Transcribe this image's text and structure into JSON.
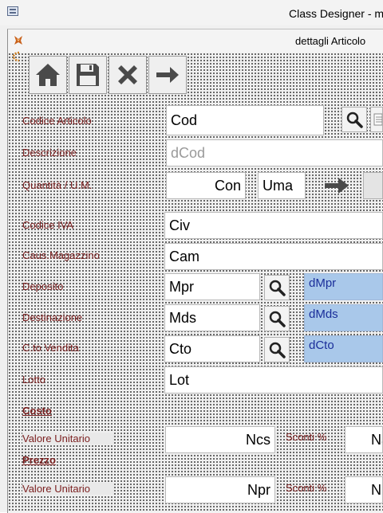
{
  "window": {
    "title": "Class Designer - m"
  },
  "form": {
    "title": "dettagli Articolo"
  },
  "toolbar": {
    "home": {
      "icon": "home-icon"
    },
    "save": {
      "icon": "save-icon"
    },
    "cancel": {
      "icon": "close-icon"
    },
    "next": {
      "icon": "arrow-right-icon"
    }
  },
  "labels": {
    "codice_articolo": "Codice Articolo",
    "descrizione": "Descrizione",
    "quantita_um": "Quantità / U.M.",
    "codice_iva": "Codice IVA",
    "caus_magazzino": "Caus.Magazzino",
    "deposito": "Deposito",
    "destinazione": "Destinazione",
    "cto_vendita": "C.to Vendita",
    "lotto": "Lotto",
    "costo": "Costo",
    "valore_unitario_costo": "Valore Unitario",
    "sconti_costo": "Sconti %",
    "prezzo": "Prezzo",
    "valore_unitario_prezzo": "Valore Unitario",
    "sconti_prezzo": "Sconti %"
  },
  "fields": {
    "cod": "Cod",
    "dcod": "dCod",
    "con": "Con",
    "uma": "Uma",
    "civ": "Civ",
    "cam": "Cam",
    "mpr": "Mpr",
    "dmpr": "dMpr",
    "mds": "Mds",
    "dmds": "dMds",
    "cto": "Cto",
    "dcto": "dCto",
    "lot": "Lot",
    "ncs": "Ncs",
    "sconti_costo_val": "Na",
    "npr": "Npr",
    "sconti_prezzo_val": "N"
  },
  "colors": {
    "label": "#7a1e1e",
    "lookup_bg": "#a9c8ea",
    "lookup_text": "#1a2e9a"
  }
}
